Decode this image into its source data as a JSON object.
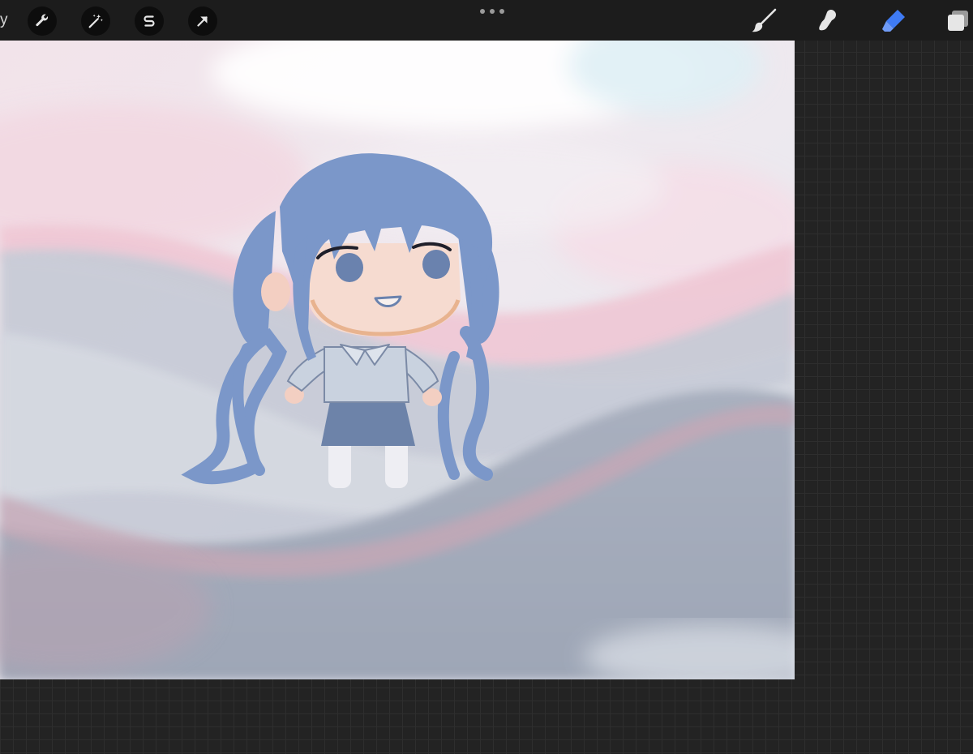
{
  "toolbar": {
    "gallery_fragment": "y",
    "left_tools": [
      {
        "icon": "wrench-icon",
        "name": "actions"
      },
      {
        "icon": "magic-wand-icon",
        "name": "adjustments"
      },
      {
        "icon": "selection-s-icon",
        "name": "selection"
      },
      {
        "icon": "arrow-cursor-icon",
        "name": "transform"
      }
    ],
    "right_tools": [
      {
        "icon": "brush-icon",
        "name": "paint",
        "active": false
      },
      {
        "icon": "smudge-icon",
        "name": "smudge",
        "active": false
      },
      {
        "icon": "eraser-icon",
        "name": "erase",
        "active": true
      },
      {
        "icon": "layers-icon",
        "name": "layers",
        "active": false
      }
    ]
  },
  "colors": {
    "toolbar_bg": "#1c1c1c",
    "workspace_bg": "#232323",
    "active_tool": "#3f7bf4",
    "inactive_tool": "#e6e6e6"
  }
}
